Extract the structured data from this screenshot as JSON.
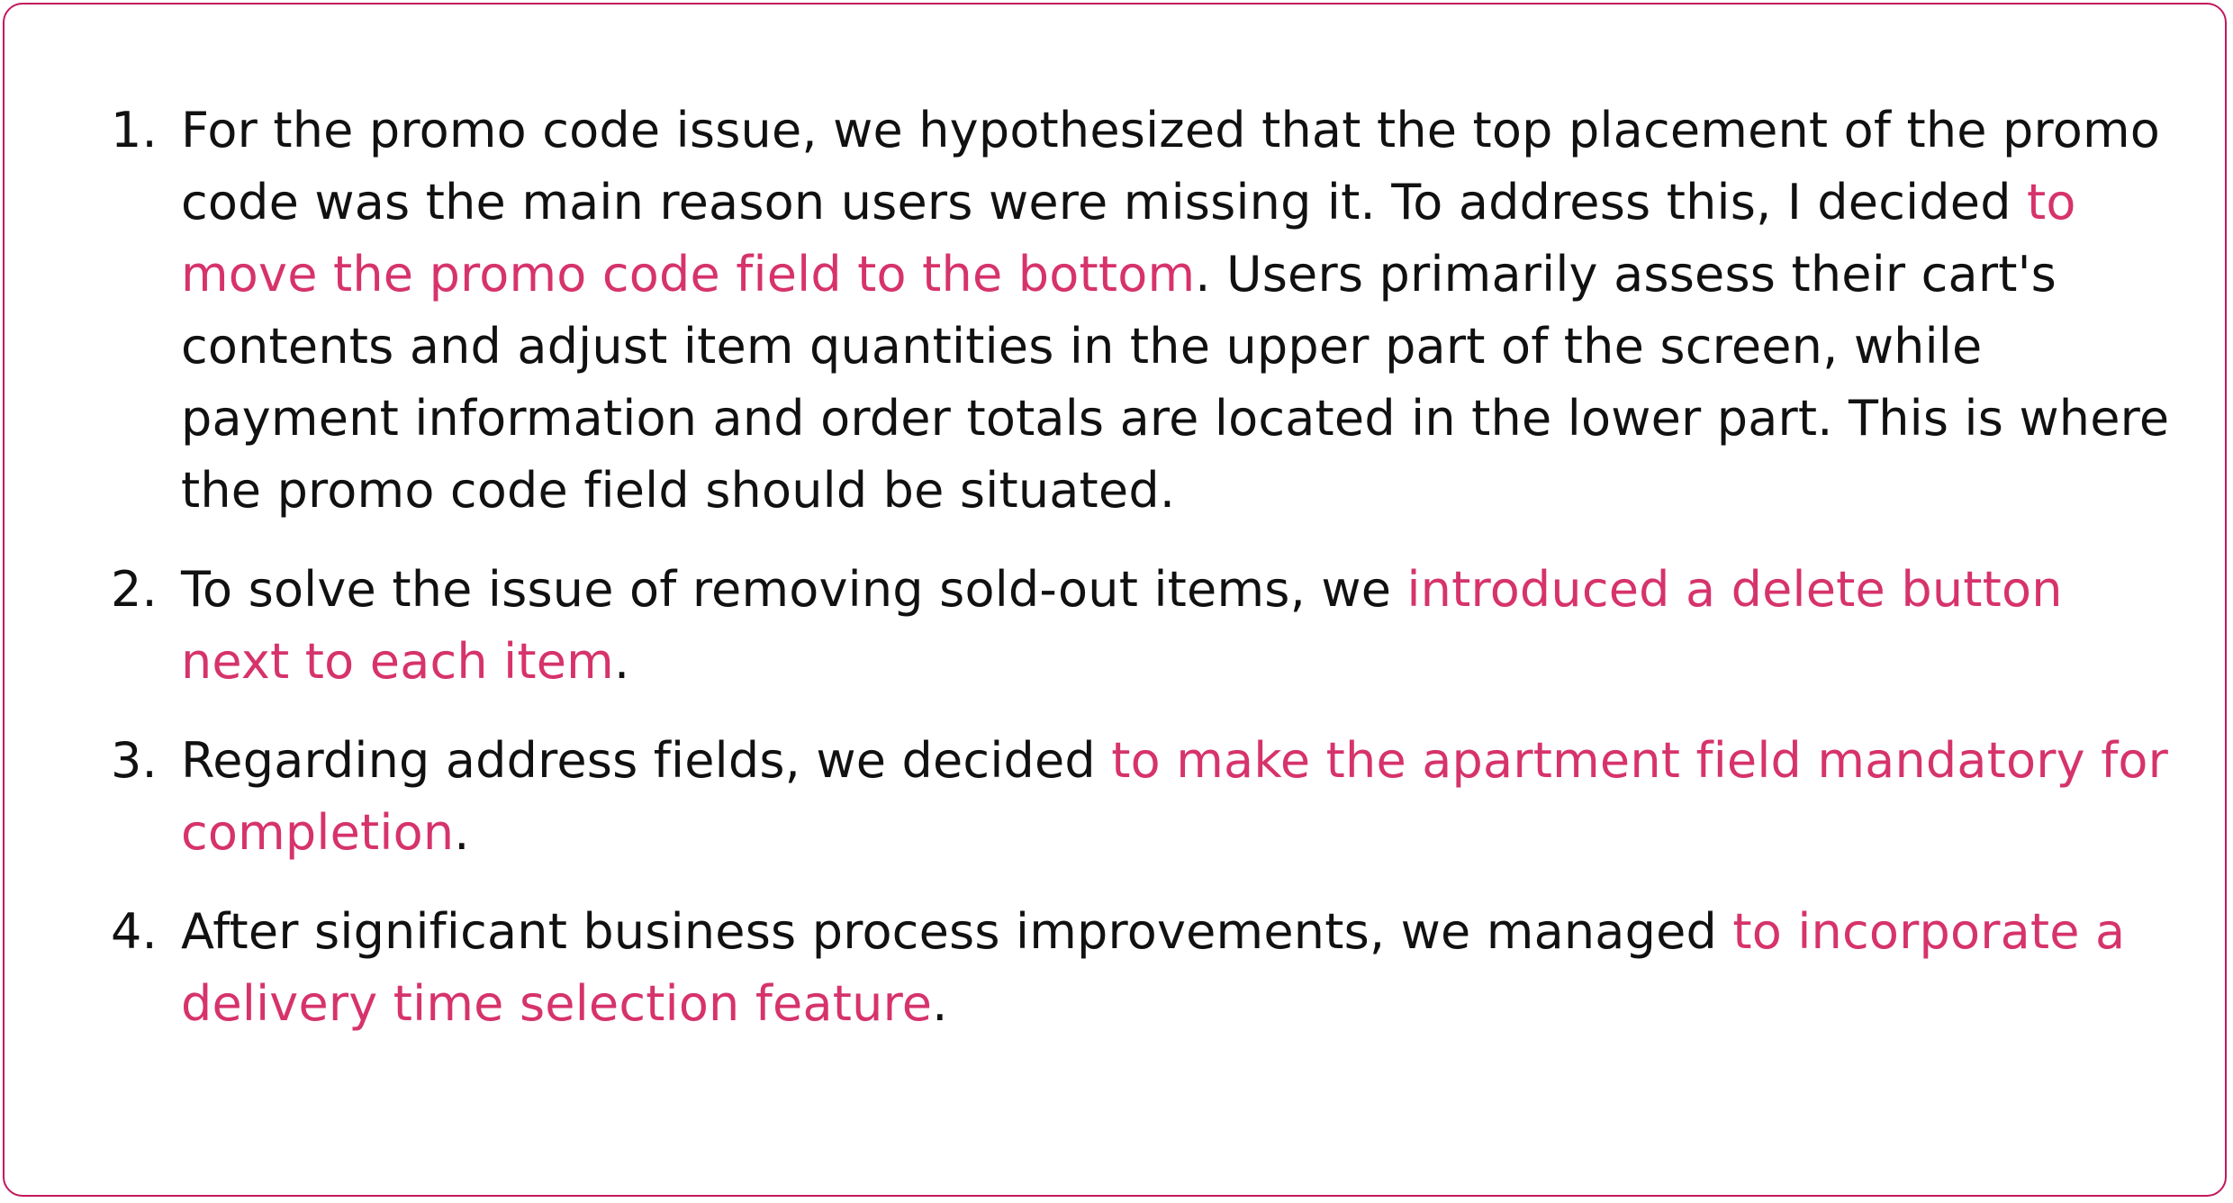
{
  "colors": {
    "border": "#c2185b",
    "highlight": "#d6336c",
    "text": "#111111"
  },
  "items": [
    {
      "number": "1.",
      "before": "For the promo code issue, we hypothesized that the top placement of the promo code was the main reason users were missing it. To address this, I decided ",
      "highlight": "to move the promo code field to the bottom",
      "after": ". Users primarily assess their cart's contents and adjust item quantities in the upper part of the screen, while payment information and order totals are located in the lower part. This is where the promo code field should be situated."
    },
    {
      "number": "2.",
      "before": "To solve the issue of removing sold-out items, we ",
      "highlight": "introduced a delete button next to each item",
      "after": "."
    },
    {
      "number": "3.",
      "before": "Regarding address fields, we decided ",
      "highlight": "to make the apartment field mandatory for completion",
      "after": "."
    },
    {
      "number": "4.",
      "before": "After significant business process improvements, we managed ",
      "highlight": "to incorporate a delivery time selection feature",
      "after": "."
    }
  ]
}
